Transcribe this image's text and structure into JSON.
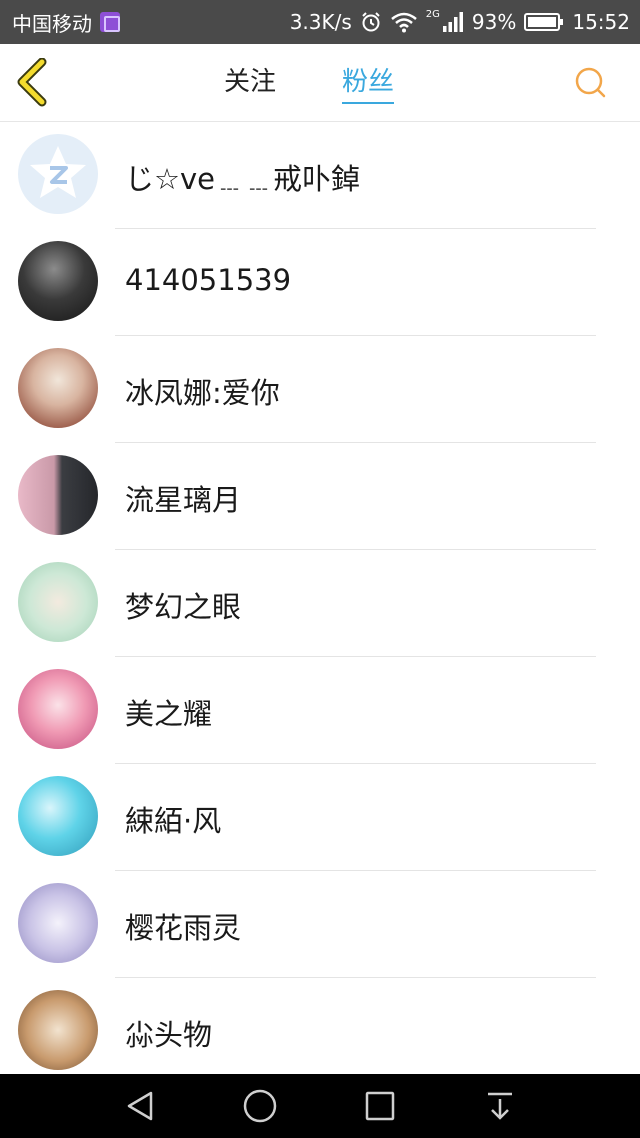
{
  "status_bar": {
    "carrier": "中国移动",
    "net_speed": "3.3K/s",
    "network_type": "2G",
    "battery": "93%",
    "time": "15:52"
  },
  "header": {
    "tabs": [
      {
        "label": "关注",
        "active": false
      },
      {
        "label": "粉丝",
        "active": true
      }
    ],
    "accent_color": "#3aa8de",
    "back_icon": "chevron-left-icon",
    "search_icon": "search-icon"
  },
  "fans": [
    {
      "name": "じ☆ve﹍﹍戒卟鋽"
    },
    {
      "name": "414051539"
    },
    {
      "name": "冰凤娜:爱你"
    },
    {
      "name": "流星璃月"
    },
    {
      "name": "梦幻之眼"
    },
    {
      "name": "美之耀"
    },
    {
      "name": "綀絔·风"
    },
    {
      "name": "樱花雨灵"
    },
    {
      "name": "尛头物"
    }
  ]
}
